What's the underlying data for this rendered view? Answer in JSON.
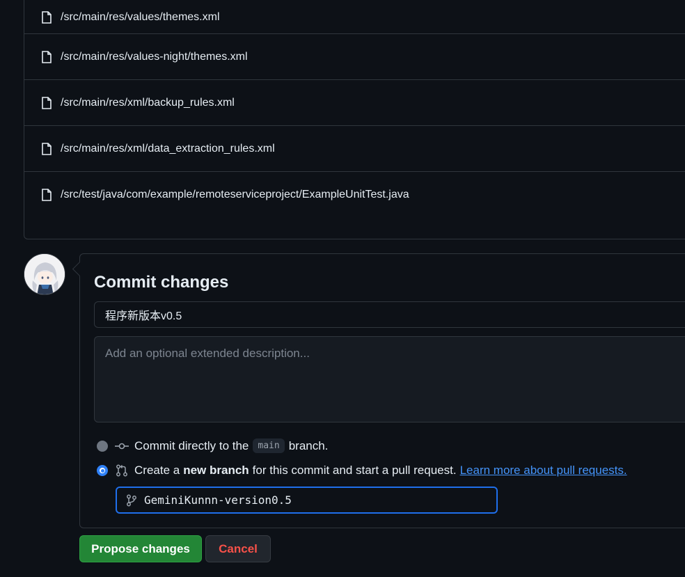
{
  "files": [
    "/src/main/res/values/themes.xml",
    "/src/main/res/values-night/themes.xml",
    "/src/main/res/xml/backup_rules.xml",
    "/src/main/res/xml/data_extraction_rules.xml",
    "/src/test/java/com/example/remoteserviceproject/ExampleUnitTest.java"
  ],
  "commit": {
    "title": "Commit changes",
    "summary_value": "程序新版本v0.5",
    "description_placeholder": "Add an optional extended description...",
    "option_direct": {
      "prefix": "Commit directly to the",
      "branch": "main",
      "suffix": "branch."
    },
    "option_new_branch": {
      "prefix": "Create a",
      "strong": "new branch",
      "suffix": "for this commit and start a pull request.",
      "link": "Learn more about pull requests."
    },
    "branch_name_value": "GeminiKunnn-version0.5",
    "selected_option": "new_branch"
  },
  "buttons": {
    "propose": "Propose changes",
    "cancel": "Cancel"
  },
  "colors": {
    "background": "#0d1117",
    "border": "#30363d",
    "accent_blue": "#2f81f7",
    "propose_green": "#238636",
    "cancel_red": "#f85149",
    "link": "#4493f8"
  }
}
